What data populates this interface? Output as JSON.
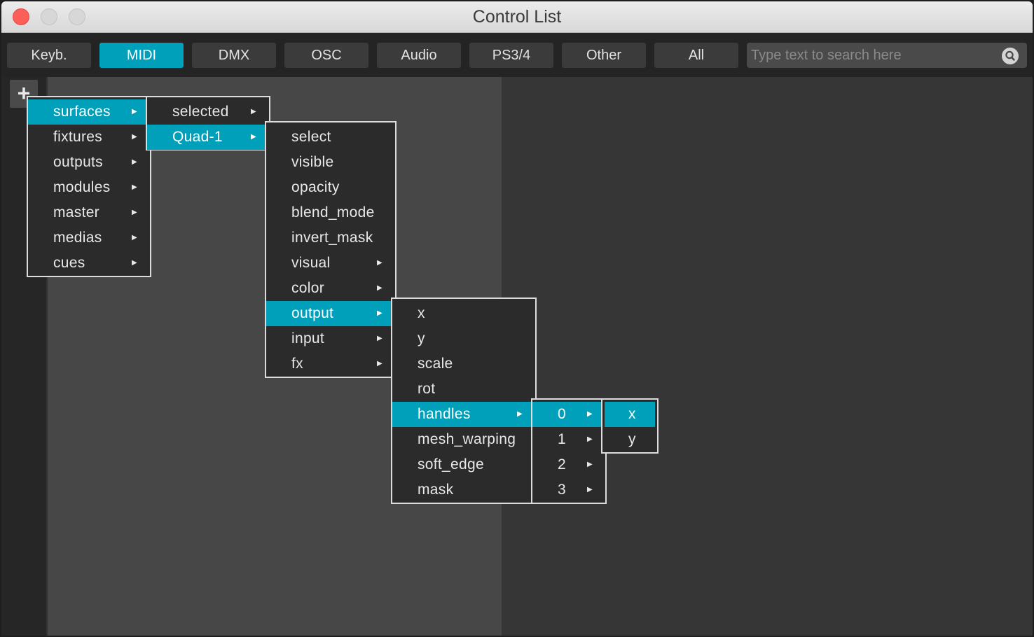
{
  "window": {
    "title": "Control List"
  },
  "tabs": [
    {
      "label": "Keyb.",
      "active": false
    },
    {
      "label": "MIDI",
      "active": true
    },
    {
      "label": "DMX",
      "active": false
    },
    {
      "label": "OSC",
      "active": false
    },
    {
      "label": "Audio",
      "active": false
    },
    {
      "label": "PS3/4",
      "active": false
    },
    {
      "label": "Other",
      "active": false
    },
    {
      "label": "All",
      "active": false
    }
  ],
  "search": {
    "placeholder": "Type text to search here",
    "icon": "search-icon"
  },
  "sidebar": {
    "add_label": "+"
  },
  "accent_color": "#00a0bb",
  "menus": {
    "level1": [
      {
        "label": "surfaces",
        "selected": true,
        "submenu": true
      },
      {
        "label": "fixtures",
        "submenu": true
      },
      {
        "label": "outputs",
        "submenu": true
      },
      {
        "label": "modules",
        "submenu": true
      },
      {
        "label": "master",
        "submenu": true
      },
      {
        "label": "medias",
        "submenu": true
      },
      {
        "label": "cues",
        "submenu": true
      }
    ],
    "level2": [
      {
        "label": "selected",
        "submenu": true
      },
      {
        "label": "Quad-1",
        "selected": true,
        "submenu": true
      }
    ],
    "level3": [
      {
        "label": "select"
      },
      {
        "label": "visible"
      },
      {
        "label": "opacity"
      },
      {
        "label": "blend_mode"
      },
      {
        "label": "invert_mask"
      },
      {
        "label": "visual",
        "submenu": true
      },
      {
        "label": "color",
        "submenu": true
      },
      {
        "label": "output",
        "selected": true,
        "submenu": true
      },
      {
        "label": "input",
        "submenu": true
      },
      {
        "label": "fx",
        "submenu": true
      }
    ],
    "level4": [
      {
        "label": "x"
      },
      {
        "label": "y"
      },
      {
        "label": "scale"
      },
      {
        "label": "rot"
      },
      {
        "label": "handles",
        "selected": true,
        "submenu": true
      },
      {
        "label": "mesh_warping"
      },
      {
        "label": "soft_edge"
      },
      {
        "label": "mask"
      }
    ],
    "level5": [
      {
        "label": "0",
        "selected": true,
        "submenu": true
      },
      {
        "label": "1",
        "submenu": true
      },
      {
        "label": "2",
        "submenu": true
      },
      {
        "label": "3",
        "submenu": true
      }
    ],
    "level6": [
      {
        "label": "x",
        "selected": true
      },
      {
        "label": "y"
      }
    ]
  }
}
